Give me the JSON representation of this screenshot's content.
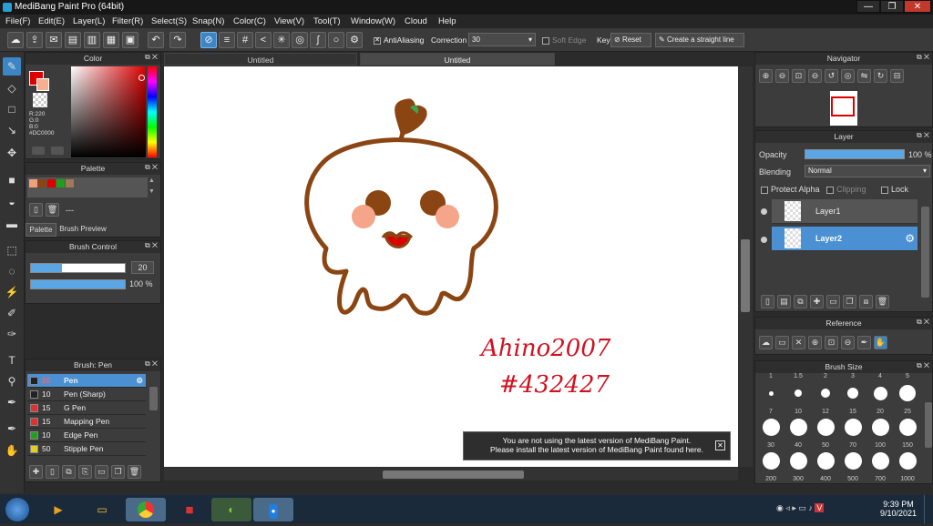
{
  "window": {
    "title": "MediBang Paint Pro (64bit)",
    "min": "—",
    "max": "❐",
    "close": "✕"
  },
  "menu": [
    "File(F)",
    "Edit(E)",
    "Layer(L)",
    "Filter(R)",
    "Select(S)",
    "Snap(N)",
    "Color(C)",
    "View(V)",
    "Tool(T)",
    "Window(W)",
    "Cloud",
    "Help"
  ],
  "toolbar": {
    "antialias_label": "AntiAliasing",
    "correction_label": "Correction",
    "correction_value": "30",
    "soft_edge_label": "Soft Edge",
    "key_label": "Key",
    "reset_label": "Reset",
    "straight_line_label": "Create a straight line"
  },
  "tabs": [
    "Untitled",
    "Untitled"
  ],
  "color_panel": {
    "title": "Color",
    "r": "R:220",
    "g": "G:0",
    "b": "B:0",
    "hex": "#DC0000",
    "main_color": "#dc0000"
  },
  "palette_panel": {
    "title": "Palette",
    "name": "---",
    "tab1": "Palette",
    "tab2": "Brush Preview",
    "swatches": [
      "#f0a07a",
      "#8b4513",
      "#dc0000",
      "#1ea01e",
      "#a0785a"
    ]
  },
  "brush_control": {
    "title": "Brush Control",
    "size": "20",
    "opacity": "100 %",
    "size_fill": 0.33,
    "opacity_fill": 1.0
  },
  "brush_panel": {
    "title": "Brush: Pen",
    "items": [
      {
        "size": "20",
        "name": "Pen",
        "color": "#222222"
      },
      {
        "size": "10",
        "name": "Pen (Sharp)",
        "color": "#222222"
      },
      {
        "size": "15",
        "name": "G Pen",
        "color": "#e03030"
      },
      {
        "size": "15",
        "name": "Mapping Pen",
        "color": "#e03030"
      },
      {
        "size": "10",
        "name": "Edge Pen",
        "color": "#20a020"
      },
      {
        "size": "50",
        "name": "Stipple Pen",
        "color": "#e0d020"
      }
    ]
  },
  "navigator": {
    "title": "Navigator"
  },
  "layer_panel": {
    "title": "Layer",
    "opacity_label": "Opacity",
    "opacity_value": "100 %",
    "blending_label": "Blending",
    "blending_value": "Normal",
    "protect_alpha": "Protect Alpha",
    "clipping": "Clipping",
    "lock": "Lock",
    "layers": [
      "Layer1",
      "Layer2"
    ]
  },
  "reference": {
    "title": "Reference"
  },
  "brush_size": {
    "title": "Brush Size",
    "top_row": [
      "1",
      "1.5",
      "2",
      "3",
      "4",
      "5"
    ],
    "rows": [
      [
        "7",
        "10",
        "12",
        "15",
        "20",
        "25"
      ],
      [
        "30",
        "40",
        "50",
        "70",
        "100",
        "150"
      ],
      [
        "200",
        "300",
        "400",
        "500",
        "700",
        "1000"
      ]
    ]
  },
  "notification": {
    "line1": "You are not using the latest version of MediBang Paint.",
    "line2": "Please install the latest version of MediBang Paint found here.",
    "close": "✕"
  },
  "signature": {
    "line1": "Ahino2007",
    "line2": "#432427"
  },
  "taskbar": {
    "time": "9:39 PM",
    "date": "9/10/2021"
  }
}
